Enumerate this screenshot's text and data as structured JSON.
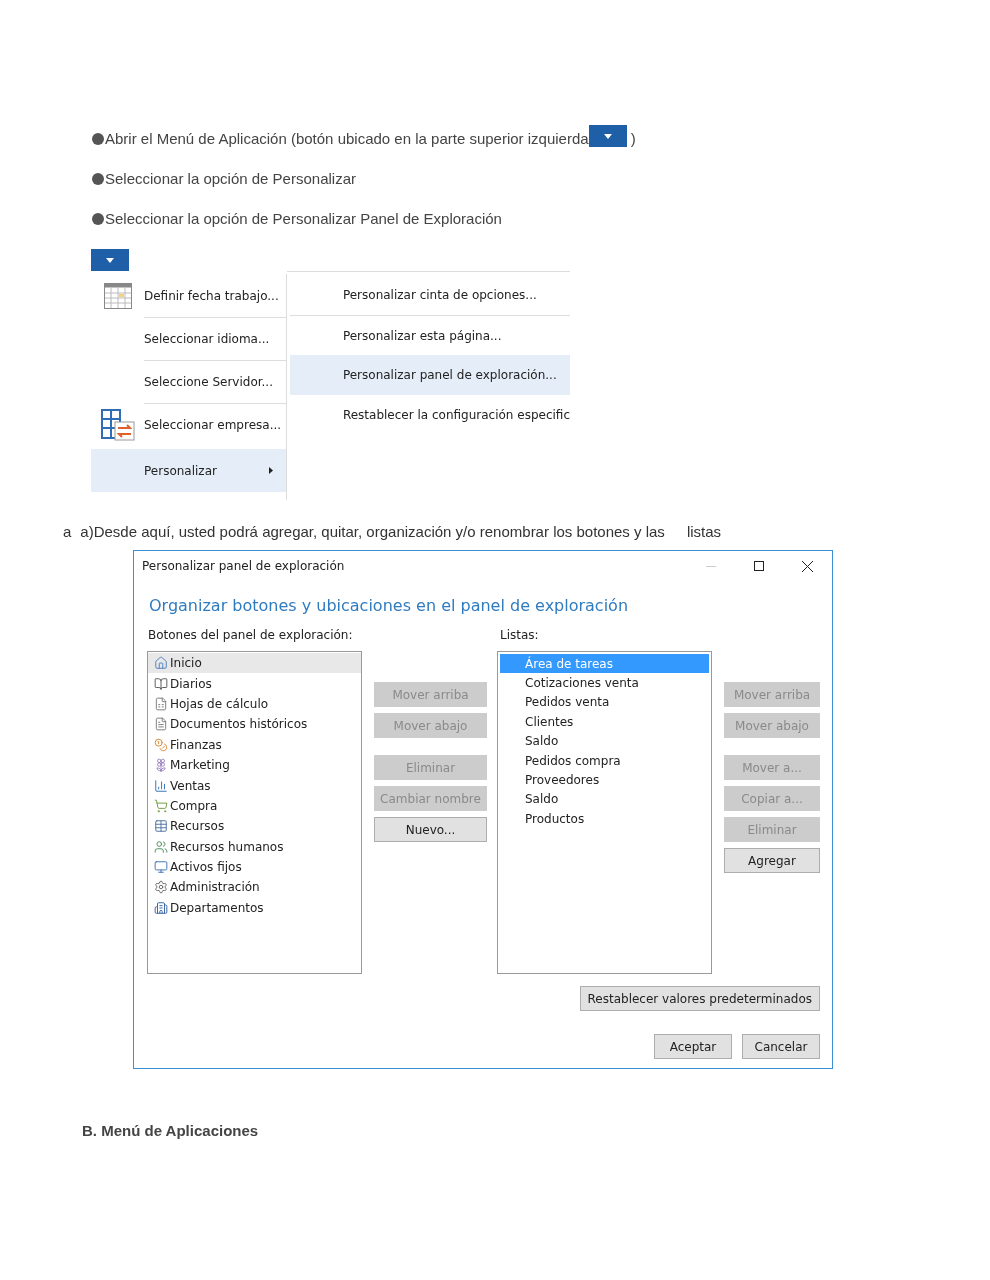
{
  "steps": [
    {
      "text": "Abrir el Menú de Aplicación (botón ubicado en la parte superior izquierda",
      "after": ")",
      "has_button": true
    },
    {
      "text": "Seleccionar la opción de Personalizar",
      "has_button": false
    },
    {
      "text": "Seleccionar la opción de Personalizar Panel de Exploración",
      "has_button": false
    }
  ],
  "app_menu": {
    "left_items": [
      {
        "label": "Definir fecha trabajo...",
        "kind": "calendar",
        "selected": false,
        "submenu": false
      },
      {
        "label": "Seleccionar idioma...",
        "kind": "plain",
        "selected": false,
        "submenu": false
      },
      {
        "label": "Seleccione Servidor...",
        "kind": "plain",
        "selected": false,
        "submenu": false
      },
      {
        "label": "Seleccionar empresa...",
        "kind": "company",
        "selected": false,
        "submenu": false
      },
      {
        "label": "Personalizar",
        "kind": "plain",
        "selected": true,
        "submenu": true
      }
    ],
    "right_items": [
      {
        "label": "Personalizar cinta de opciones...",
        "selected": false
      },
      {
        "label": "Personalizar esta página...",
        "selected": false
      },
      {
        "label": "Personalizar panel de exploración...",
        "selected": true
      },
      {
        "label": "Restablecer la configuración especific",
        "selected": false
      }
    ]
  },
  "caption": {
    "marker": "a",
    "text": "a)Desde aquí, usted podrá agregar, quitar, organización y/o renombrar los botones y las",
    "last_word": "listas"
  },
  "dialog": {
    "title": "Personalizar panel de exploración",
    "heading": "Organizar botones y ubicaciones en el panel de exploración",
    "buttons_label": "Botones del panel de exploración:",
    "lists_label": "Listas:",
    "buttons_list": [
      {
        "label": "Inicio",
        "selected": true
      },
      {
        "label": "Diarios",
        "selected": false
      },
      {
        "label": "Hojas de cálculo",
        "selected": false
      },
      {
        "label": "Documentos históricos",
        "selected": false
      },
      {
        "label": "Finanzas",
        "selected": false
      },
      {
        "label": "Marketing",
        "selected": false
      },
      {
        "label": "Ventas",
        "selected": false
      },
      {
        "label": "Compra",
        "selected": false
      },
      {
        "label": "Recursos",
        "selected": false
      },
      {
        "label": "Recursos humanos",
        "selected": false
      },
      {
        "label": "Activos fijos",
        "selected": false
      },
      {
        "label": "Administración",
        "selected": false
      },
      {
        "label": "Departamentos",
        "selected": false
      }
    ],
    "middle_button_groups": [
      {
        "buttons": [
          {
            "label": "Mover arriba",
            "disabled": true
          },
          {
            "label": "Mover abajo",
            "disabled": true
          }
        ]
      },
      {
        "buttons": [
          {
            "label": "Eliminar",
            "disabled": true
          },
          {
            "label": "Cambiar nombre",
            "disabled": true
          },
          {
            "label": "Nuevo...",
            "disabled": false
          }
        ]
      }
    ],
    "lists": [
      {
        "label": "Área de tareas",
        "selected": true
      },
      {
        "label": "Cotizaciones venta",
        "selected": false
      },
      {
        "label": "Pedidos venta",
        "selected": false
      },
      {
        "label": "Clientes",
        "selected": false
      },
      {
        "label": "Saldo",
        "selected": false
      },
      {
        "label": "Pedidos compra",
        "selected": false
      },
      {
        "label": "Proveedores",
        "selected": false
      },
      {
        "label": "Saldo",
        "selected": false
      },
      {
        "label": "Productos",
        "selected": false
      }
    ],
    "right_button_groups": [
      {
        "buttons": [
          {
            "label": "Mover arriba",
            "disabled": true
          },
          {
            "label": "Mover abajo",
            "disabled": true
          }
        ]
      },
      {
        "buttons": [
          {
            "label": "Mover a...",
            "disabled": true
          },
          {
            "label": "Copiar a...",
            "disabled": true
          },
          {
            "label": "Eliminar",
            "disabled": true
          },
          {
            "label": "Agregar",
            "disabled": false
          }
        ]
      }
    ],
    "reset_button": "Restablecer valores predeterminados",
    "ok_button": "Aceptar",
    "cancel_button": "Cancelar"
  },
  "section_heading": "B. Menú de Aplicaciones"
}
